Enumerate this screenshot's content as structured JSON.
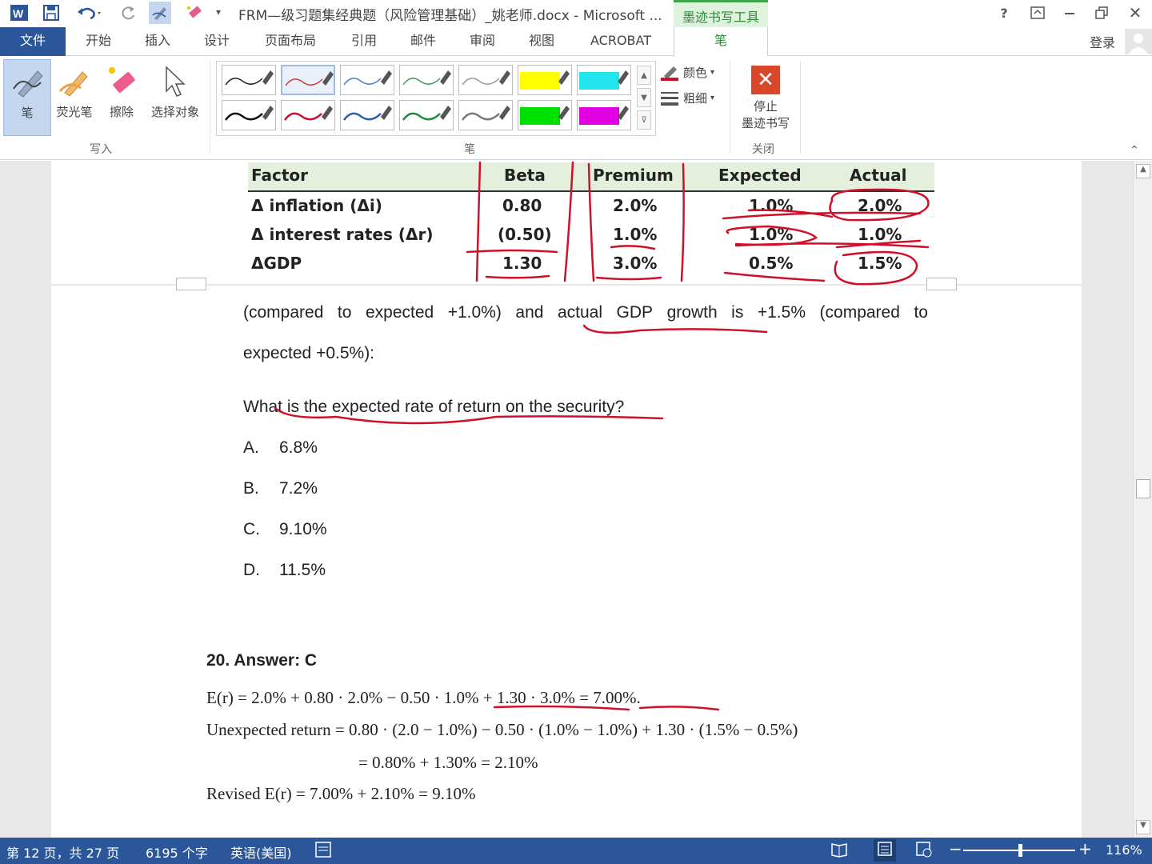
{
  "titlebar": {
    "doc_title": "FRM—级习题集经典题（风险管理基础）_姚老师.docx - Microsoft ...",
    "context_tab": "墨迹书写工具"
  },
  "tabs": {
    "file": "文件",
    "items": [
      "开始",
      "插入",
      "设计",
      "页面布局",
      "引用",
      "邮件",
      "审阅",
      "视图",
      "ACROBAT"
    ],
    "pen": "笔",
    "login": "登录"
  },
  "ribbon": {
    "tools": {
      "pen": "笔",
      "highlighter": "荧光笔",
      "eraser": "擦除",
      "select": "选择对象"
    },
    "group_write": "写入",
    "group_pens": "笔",
    "group_close": "关闭",
    "color": "颜色",
    "thickness": "粗细",
    "stop_line1": "停止",
    "stop_line2": "墨迹书写",
    "pen_colors_row1": [
      "#222222",
      "#d23a3a",
      "#4a7fc0",
      "#3a9a5a",
      "#9a9a9a",
      "#ffff00",
      "#22e5ee"
    ],
    "pen_colors_row2": [
      "#111111",
      "#c8102e",
      "#2d5fa8",
      "#1f8a3f",
      "#777777",
      "#00e000",
      "#e000e0"
    ]
  },
  "table": {
    "headers": [
      "Factor",
      "Beta",
      "Premium",
      "Expected",
      "Actual"
    ],
    "rows": [
      {
        "factor": "Δ inflation (Δi)",
        "beta": "0.80",
        "premium": "2.0%",
        "expected": "1.0%",
        "actual": "2.0%"
      },
      {
        "factor": "Δ interest rates (Δr)",
        "beta": "(0.50)",
        "premium": "1.0%",
        "expected": "1.0%",
        "actual": "1.0%"
      },
      {
        "factor": "ΔGDP",
        "beta": "1.30",
        "premium": "3.0%",
        "expected": "0.5%",
        "actual": "1.5%"
      }
    ]
  },
  "question": {
    "line1_start": "(compared",
    "line1_words": [
      "to",
      "expected",
      "+1.0%)",
      "and",
      "actual",
      "GDP",
      "growth",
      "is",
      "+1.5%",
      "(compared",
      "to"
    ],
    "line2": "expected +0.5%):",
    "prompt": "What is the expected rate of return on the security?",
    "options": [
      {
        "letter": "A.",
        "text": "6.8%"
      },
      {
        "letter": "B.",
        "text": "7.2%"
      },
      {
        "letter": "C.",
        "text": "9.10%"
      },
      {
        "letter": "D.",
        "text": "11.5%"
      }
    ]
  },
  "answer": {
    "heading": "20.  Answer: C",
    "eq1": "E(r) = 2.0% + 0.80 · 2.0% − 0.50 · 1.0% + 1.30 · 3.0% = 7.00%.",
    "eq2": "Unexpected return = 0.80 · (2.0 − 1.0%) − 0.50 · (1.0% − 1.0%) + 1.30 · (1.5% − 0.5%)",
    "eq3": "= 0.80% + 1.30% = 2.10%",
    "eq4": "Revised E(r) = 7.00% + 2.10% = 9.10%"
  },
  "status": {
    "page": "第 12 页，共 27 页",
    "words": "6195 个字",
    "lang": "英语(美国)",
    "zoom": "116%"
  },
  "ink_color": "#d0102a"
}
